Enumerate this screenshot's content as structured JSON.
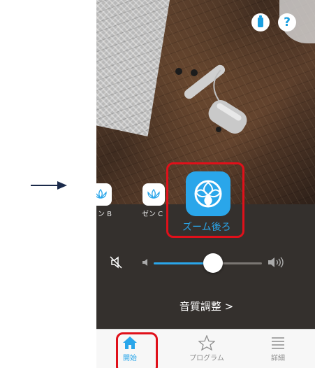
{
  "program_list": {
    "items": [
      {
        "label": "ン B",
        "icon": "lotus-icon"
      },
      {
        "label": "ゼン C",
        "icon": "lotus-icon"
      }
    ],
    "selected": {
      "label": "ズーム後ろ",
      "icon": "zoom-rear-icon"
    }
  },
  "header": {
    "battery_icon": "battery-icon",
    "help_label": "?"
  },
  "volume": {
    "level": 0.55,
    "mute_icon": "speaker-mute-icon",
    "low_icon": "volume-low-icon",
    "high_icon": "volume-high-icon"
  },
  "sound_adjust": {
    "label": "音質調整 >"
  },
  "tabs": [
    {
      "label": "開始",
      "icon": "home-icon",
      "active": true
    },
    {
      "label": "プログラム",
      "icon": "star-icon",
      "active": false
    },
    {
      "label": "詳細",
      "icon": "list-icon",
      "active": false
    }
  ],
  "colors": {
    "accent": "#2aa6ea",
    "highlight": "#e0101a",
    "panel": "#34302d"
  }
}
